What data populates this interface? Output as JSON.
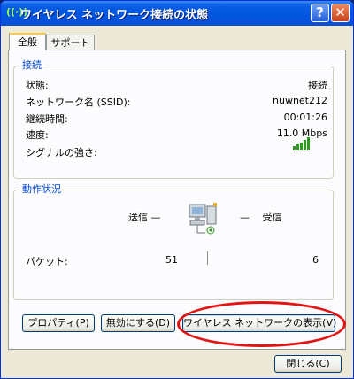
{
  "window": {
    "title": "ワイヤレス ネットワーク接続の状態",
    "icon_text": "((·))",
    "help_label": "?",
    "close_label": "✕"
  },
  "tabs": [
    {
      "label": "全般",
      "active": true
    },
    {
      "label": "サポート",
      "active": false
    }
  ],
  "connection": {
    "group_title": "接続",
    "rows": [
      {
        "label": "状態:",
        "value": "接続"
      },
      {
        "label": "ネットワーク名 (SSID):",
        "value": "nuwnet212"
      },
      {
        "label": "継続時間:",
        "value": "00:01:26"
      },
      {
        "label": "速度:",
        "value": "11.0 Mbps"
      },
      {
        "label": "シグナルの強さ:",
        "value": ""
      }
    ],
    "signal_bars": 5,
    "signal_color": "#2c9a1c"
  },
  "activity": {
    "group_title": "動作状況",
    "sent_label": "送信 —",
    "recv_label": "— 　受信",
    "packets_label": "パケット:",
    "packets_sent": "51",
    "packets_received": "6",
    "icon": "network-computers-icon"
  },
  "buttons": {
    "properties": "プロパティ(P)",
    "disable": "無効にする(D)",
    "view_networks": "ワイヤレス ネットワークの表示(V)",
    "close": "閉じる(C)"
  },
  "highlight_color": "#e31414"
}
